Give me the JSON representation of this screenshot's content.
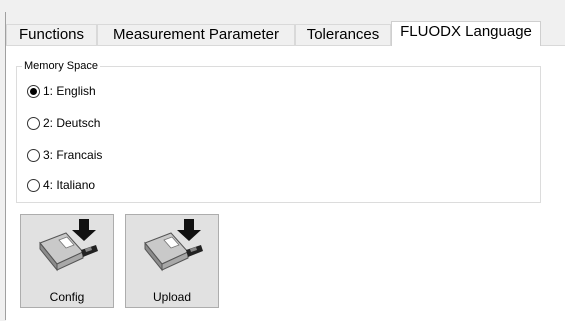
{
  "tabs": [
    {
      "label": "Functions",
      "active": false
    },
    {
      "label": "Measurement Parameter",
      "active": false
    },
    {
      "label": "Tolerances",
      "active": false
    },
    {
      "label": "FLUODX Language",
      "active": true
    }
  ],
  "memory_space": {
    "legend": "Memory Space",
    "selected": "1: English",
    "options": [
      "1: English",
      "2: Deutsch",
      "3: Francais",
      "4: Italiano"
    ]
  },
  "buttons": {
    "config_label": "Config",
    "upload_label": "Upload",
    "icon": "usb-drive-download-icon"
  },
  "colors": {
    "panel_bg": "#ffffff",
    "window_bg": "#f0f0f0",
    "button_bg": "#e1e1e1"
  }
}
